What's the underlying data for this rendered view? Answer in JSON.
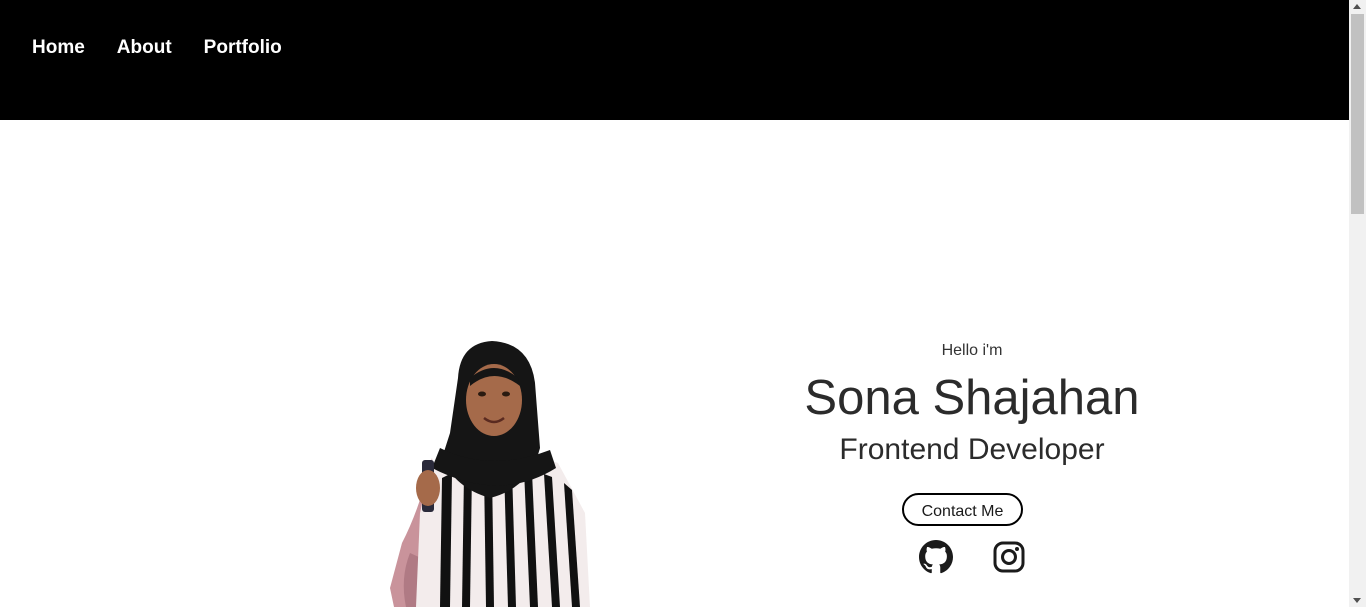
{
  "nav": {
    "items": [
      {
        "label": "Home"
      },
      {
        "label": "About"
      },
      {
        "label": "Portfolio"
      }
    ]
  },
  "hero": {
    "greeting": "Hello i'm",
    "name": "Sona Shajahan",
    "role": "Frontend Developer",
    "contact_label": "Contact Me",
    "photo_icon": "profile-photo",
    "social": [
      {
        "icon": "github-icon"
      },
      {
        "icon": "instagram-icon"
      }
    ]
  },
  "colors": {
    "nav_bg": "#000000",
    "nav_text": "#ffffff",
    "page_bg": "#ffffff",
    "text": "#2b2b2b"
  }
}
